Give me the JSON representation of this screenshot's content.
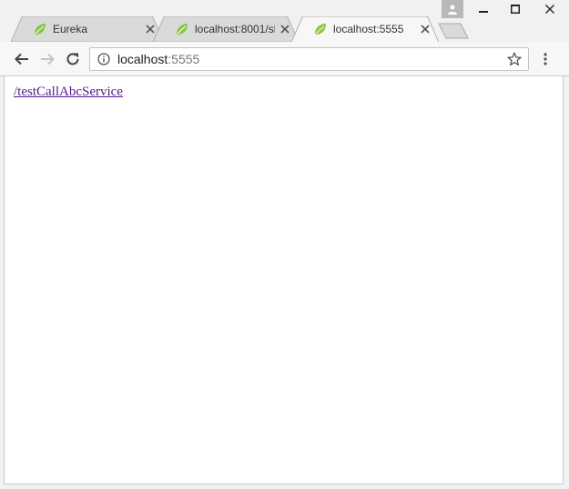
{
  "tabs": [
    {
      "title": "Eureka",
      "favicon": "spring-leaf-icon",
      "active": false
    },
    {
      "title": "localhost:8001/sh",
      "favicon": "spring-leaf-icon",
      "active": false
    },
    {
      "title": "localhost:5555",
      "favicon": "spring-leaf-icon",
      "active": true
    }
  ],
  "toolbar": {
    "back_icon": "back-arrow-icon",
    "forward_icon": "forward-arrow-icon",
    "reload_icon": "reload-icon",
    "menu_icon": "more-vert-icon"
  },
  "omnibox": {
    "host": "localhost",
    "port": ":5555",
    "info_icon": "info-icon",
    "bookmark_icon": "star-icon"
  },
  "page": {
    "link_text": "/testCallAbcService"
  },
  "colors": {
    "visited_link": "#551a8b",
    "leaf_green": "#8cc63e",
    "tab_active": "#f7f7f7",
    "tab_inactive": "#dadada"
  }
}
